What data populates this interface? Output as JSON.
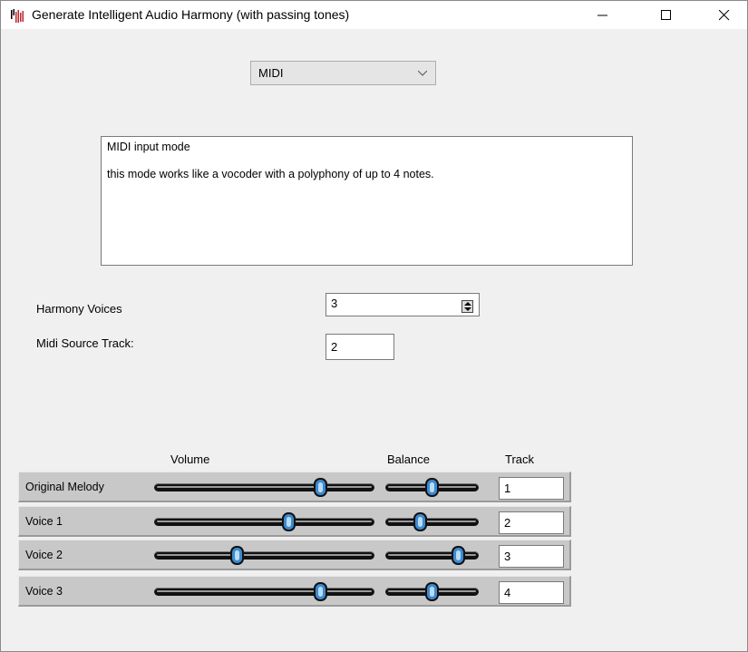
{
  "window": {
    "title": "Generate Intelligent Audio Harmony (with passing tones)",
    "icon": "audio-harmony-app-icon"
  },
  "mode": {
    "selected": "MIDI"
  },
  "description": {
    "line1": "MIDI input mode",
    "line2": "this mode works like a vocoder with a polyphony of up to 4 notes."
  },
  "harmony_voices": {
    "label": "Harmony Voices",
    "value": "3"
  },
  "midi_source": {
    "label": "Midi Source Track:",
    "value": "2"
  },
  "columns": {
    "volume": "Volume",
    "balance": "Balance",
    "track": "Track"
  },
  "rows": [
    {
      "label": "Original Melody",
      "volume": 0.77,
      "balance": 0.5,
      "track": "1"
    },
    {
      "label": "Voice 1",
      "volume": 0.62,
      "balance": 0.35,
      "track": "2"
    },
    {
      "label": "Voice 2",
      "volume": 0.37,
      "balance": 0.83,
      "track": "3"
    },
    {
      "label": "Voice 3",
      "volume": 0.77,
      "balance": 0.5,
      "track": "4"
    }
  ],
  "colors": {
    "thumb": "#3c8ad0",
    "row_bg": "#c8c8c8",
    "app_icon": "#c0262d"
  }
}
